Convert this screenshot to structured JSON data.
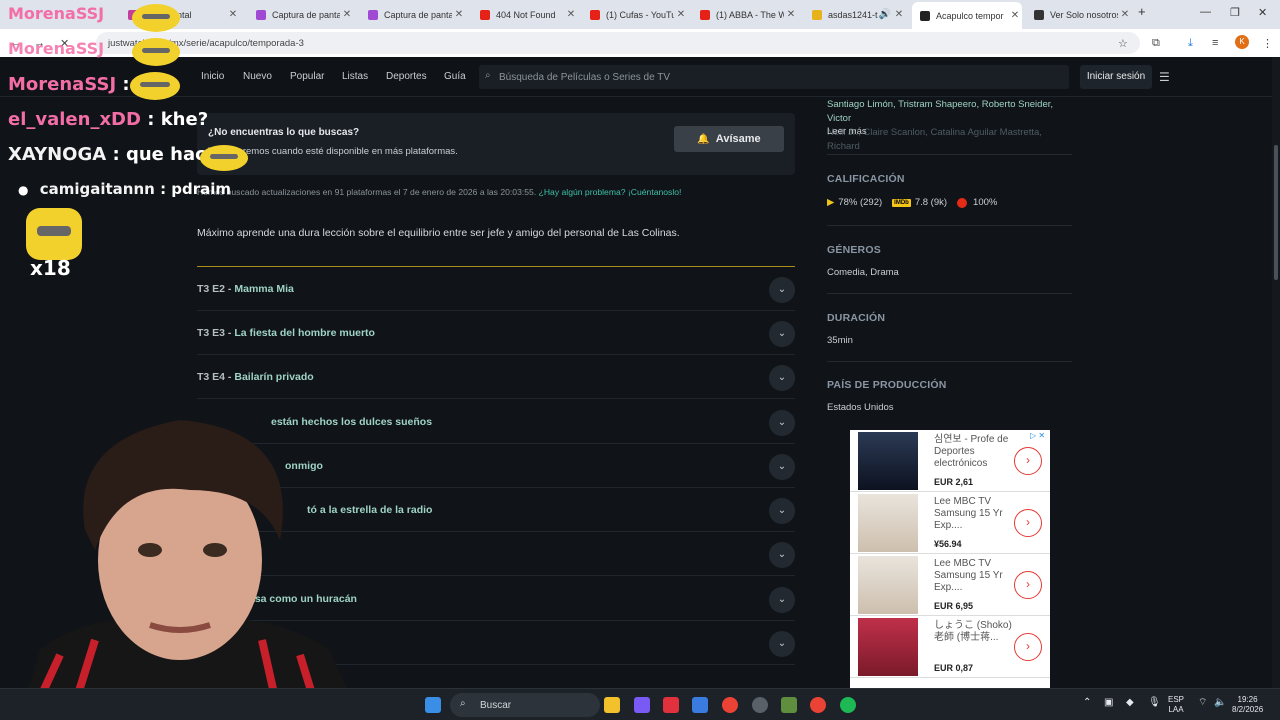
{
  "browser": {
    "tabs": [
      {
        "title": "ra de pantal"
      },
      {
        "title": "Captura de panta"
      },
      {
        "title": "Captura de panta"
      },
      {
        "title": "404 Not Found"
      },
      {
        "title": "(1) Cufas - YouTu"
      },
      {
        "title": "(1) ABBA - The W"
      },
      {
        "title": "asdas1241-ta"
      },
      {
        "title": "Acapulco tempor"
      },
      {
        "title": "Ver Solo nosotros"
      }
    ],
    "new_tab_label": "+",
    "url": "justwatch.com/mx/serie/acapulco/temporada-3",
    "profile_initial": "K"
  },
  "site_nav": {
    "links": [
      "Inicio",
      "Nuevo",
      "Popular",
      "Listas",
      "Deportes",
      "Guía"
    ],
    "search_placeholder": "Búsqueda de Películas o Series de TV",
    "login_label": "Iniciar sesión"
  },
  "notify_box": {
    "question": "¿No encuentras lo que buscas?",
    "description": "Te avisaremos cuando esté disponible en más plataformas.",
    "button_label": "Avísame"
  },
  "checked": {
    "text": "Hemos buscado actualizaciones en 91 plataformas el 7 de enero de 2026 a las 20:03:55.",
    "problem_link": "¿Hay algún problema? ¡Cuéntanoslo!"
  },
  "synopsis": "Máximo aprende una dura lección sobre el equilibrio entre ser jefe y amigo del personal de Las Colinas.",
  "episodes": [
    {
      "code": "T3 E2 -",
      "title": "Mamma Mia"
    },
    {
      "code": "T3 E3 -",
      "title": "La fiesta del hombre muerto"
    },
    {
      "code": "T3 E4 -",
      "title": "Bailarín privado"
    },
    {
      "code": "",
      "title": "están hechos los dulces sueños"
    },
    {
      "code": "",
      "title": "onmigo"
    },
    {
      "code": "",
      "title": "tó a la estrella de la radio"
    },
    {
      "code": "",
      "title": ""
    },
    {
      "code": "",
      "title": "asa como un huracán"
    },
    {
      "code": "",
      "title": ""
    }
  ],
  "sidebar": {
    "cast_visible": "Santiago Limón, Tristram Shapeero, Roberto Sneider, Victor",
    "cast_faded": "Neill Jr., Claire Scanlon, Catalina Aguilar Mastretta, Richard",
    "read_more": "Leer más",
    "rating_heading": "CALIFICACIÓN",
    "rating_jw": "78% (292)",
    "rating_imdb_badge": "IMDb",
    "rating_imdb": "7.8 (9k)",
    "rating_tomato": "100%",
    "genres_heading": "GÉNEROS",
    "genres": "Comedia, Drama",
    "duration_heading": "DURACIÓN",
    "duration": "35min",
    "country_heading": "PAÍS DE PRODUCCIÓN",
    "country": "Estados Unidos"
  },
  "ad": {
    "items": [
      {
        "title": "심연보 - Profe de Deportes electrónicos",
        "price": "EUR 2,61"
      },
      {
        "title": "Lee MBC TV Samsung 15 Yr Exp....",
        "price": "¥56.94"
      },
      {
        "title": "Lee MBC TV Samsung 15 Yr Exp....",
        "price": "EUR 6,95"
      },
      {
        "title": "しょうこ (Shoko) 老師 (博士蒋...",
        "price": "EUR 0,87"
      }
    ]
  },
  "stream_overlay": {
    "chat": [
      {
        "user": "MorenaSSJ",
        "message": ":"
      },
      {
        "user": "el_valen_xDD",
        "message": ": khe?"
      },
      {
        "user": "XAYNOGA",
        "message": ": que hace"
      },
      {
        "user": "camigaitannn",
        "message": ": pdraim"
      }
    ],
    "top_user": "MorenaSSJ",
    "combo": "x18"
  },
  "taskbar": {
    "search_label": "Buscar",
    "lang_top": "ESP",
    "lang_bottom": "LAA",
    "time": "19:26",
    "date": "8/2/2026"
  },
  "colors": {
    "accent_teal": "#3fbfa8",
    "divider_gold": "#a88f1a",
    "page_bg": "#101418"
  }
}
